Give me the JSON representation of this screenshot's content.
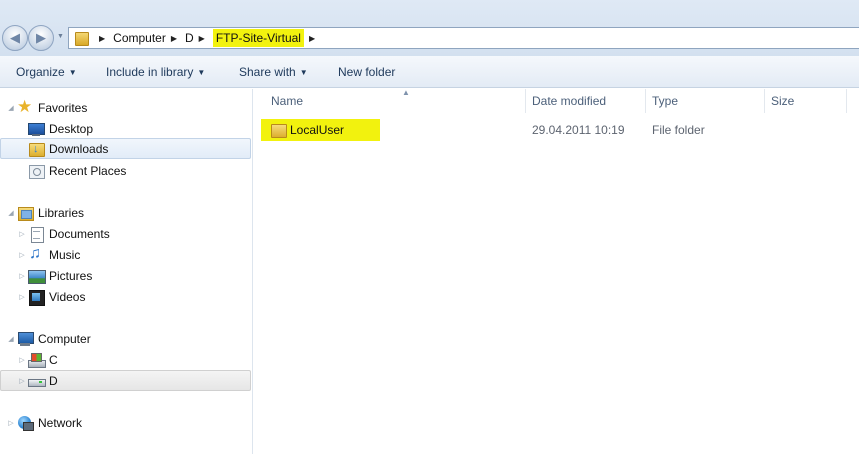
{
  "nav": {
    "back_icon": "back-arrow-icon",
    "forward_icon": "forward-arrow-icon",
    "breadcrumbs": [
      "Computer",
      "D",
      "FTP-Site-Virtual"
    ]
  },
  "toolbar": {
    "organize": "Organize",
    "include_library": "Include in library",
    "share_with": "Share with",
    "new_folder": "New folder"
  },
  "sidebar": {
    "favorites": {
      "label": "Favorites",
      "items": [
        "Desktop",
        "Downloads",
        "Recent Places"
      ]
    },
    "libraries": {
      "label": "Libraries",
      "items": [
        "Documents",
        "Music",
        "Pictures",
        "Videos"
      ]
    },
    "computer": {
      "label": "Computer",
      "items": [
        "C",
        "D"
      ]
    },
    "network": {
      "label": "Network"
    }
  },
  "columns": {
    "name": "Name",
    "date_modified": "Date modified",
    "type": "Type",
    "size": "Size"
  },
  "files": [
    {
      "name": "LocalUser",
      "date_modified": "29.04.2011 10:19",
      "type": "File folder",
      "size": ""
    }
  ],
  "colors": {
    "highlight": "#f2f20e",
    "toolbar_text": "#1e395b",
    "header_text": "#4c607a"
  }
}
